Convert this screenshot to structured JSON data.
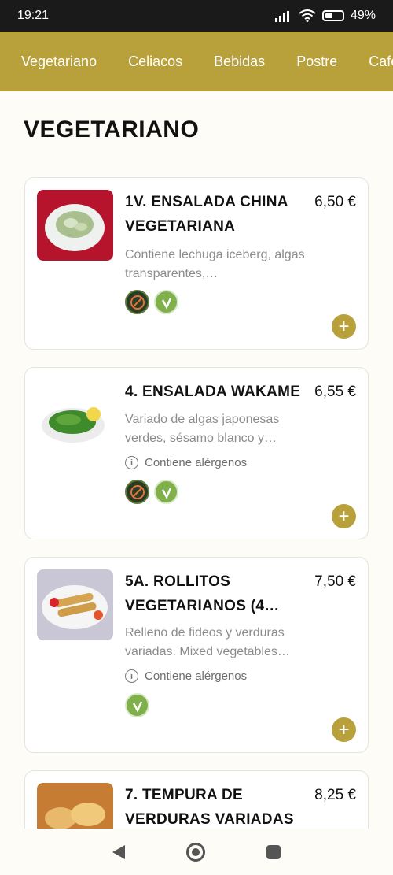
{
  "status": {
    "time": "19:21",
    "battery": "49",
    "battery_level": 0.49
  },
  "tabs": [
    "Vegetariano",
    "Celiacos",
    "Bebidas",
    "Postre",
    "Cafe"
  ],
  "section_title": "VEGETARIANO",
  "items": [
    {
      "title": "1V. ENSALADA CHINA VEGETARIANA",
      "price": "6,50 €",
      "desc": "Contiene lechuga iceberg, algas transparentes,…",
      "allergens": "",
      "badges": [
        "gluten-free-icon",
        "vegetarian-icon"
      ]
    },
    {
      "title": "4. ENSALADA WAKAME",
      "price": "6,55 €",
      "desc": "Variado de algas japonesas verdes, sésamo blanco y…",
      "allergens": "Contiene alérgenos",
      "badges": [
        "gluten-free-icon",
        "vegetarian-icon"
      ]
    },
    {
      "title": "5A. ROLLITOS VEGETARIANOS (4…",
      "price": "7,50 €",
      "desc": "Relleno de fideos y verduras variadas. Mixed vegetables…",
      "allergens": "Contiene alérgenos",
      "badges": [
        "vegetarian-icon"
      ]
    },
    {
      "title": "7. TEMPURA DE VERDURAS VARIADAS",
      "price": "8,25 €",
      "desc": "",
      "allergens": "",
      "badges": []
    }
  ],
  "add_label": "+",
  "info_label": "i",
  "colors": {
    "accent": "#b8a03a",
    "status_bar": "#1a1a1a",
    "background": "#fdfcf7"
  }
}
